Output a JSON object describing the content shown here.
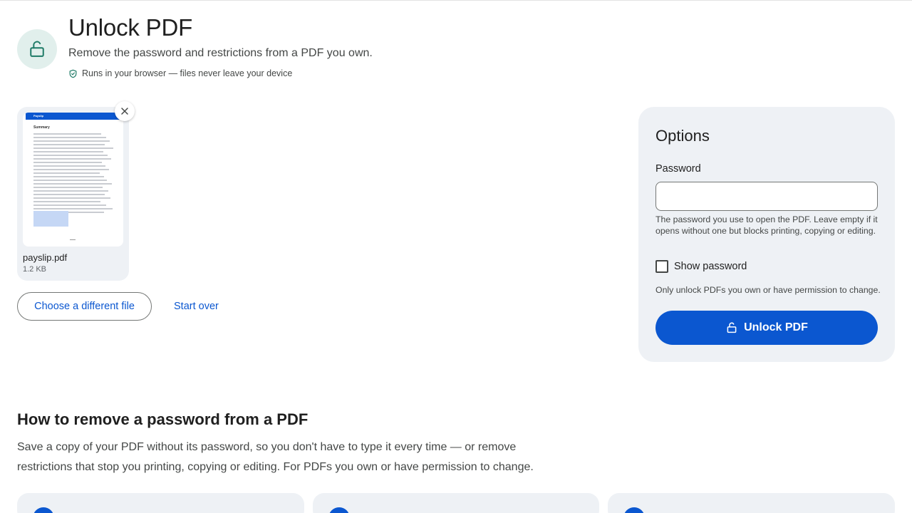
{
  "header": {
    "title": "Unlock PDF",
    "subtitle": "Remove the password and restrictions from a PDF you own.",
    "privacy_note": "Runs in your browser — files never leave your device",
    "icon": "lock-open-icon"
  },
  "file": {
    "name": "payslip.pdf",
    "size": "1.2 KB",
    "thumbnail_brand": "Payslip",
    "thumbnail_heading": "Summary",
    "remove_icon": "close-icon"
  },
  "actions": {
    "choose_file_label": "Choose a different file",
    "start_over_label": "Start over"
  },
  "options": {
    "title": "Options",
    "password_label": "Password",
    "password_value": "",
    "password_help": "The password you use to open the PDF. Leave empty if it opens without one but blocks printing, copying or editing.",
    "show_password_label": "Show password",
    "show_password_checked": false,
    "permission_note": "Only unlock PDFs you own or have permission to change.",
    "unlock_button_label": "Unlock PDF"
  },
  "howto": {
    "title": "How to remove a password from a PDF",
    "body": "Save a copy of your PDF without its password, so you don't have to type it every time — or remove restrictions that stop you printing, copying or editing. For PDFs you own or have permission to change."
  },
  "colors": {
    "accent": "#0b57d0",
    "panel": "#eef1f5",
    "icon_bg": "#e1efec",
    "icon_fg": "#1e7a66"
  }
}
